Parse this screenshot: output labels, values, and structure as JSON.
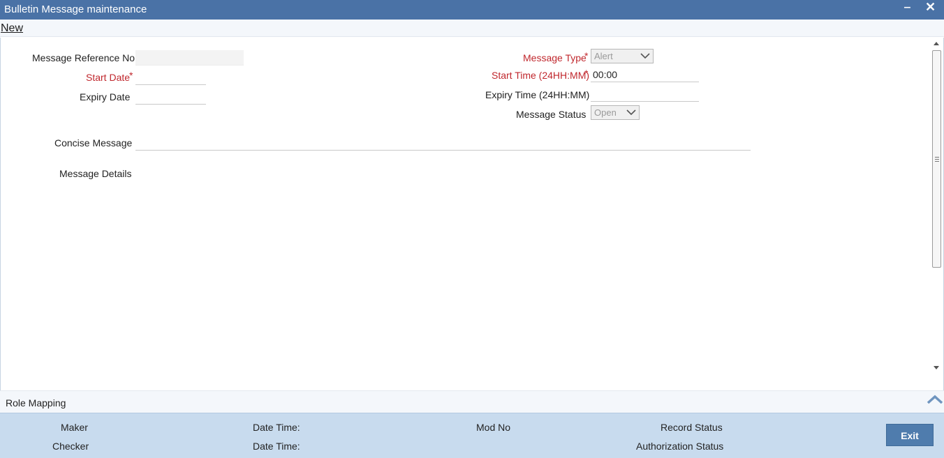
{
  "window": {
    "title": "Bulletin Message maintenance",
    "minimize_glyph": "‒",
    "close_glyph": "✕"
  },
  "toolbar": {
    "new_label": "New"
  },
  "form": {
    "message_reference_no": {
      "label": "Message Reference No",
      "value": ""
    },
    "start_date": {
      "label": "Start Date",
      "value": "",
      "required_mark": "*"
    },
    "expiry_date": {
      "label": "Expiry Date",
      "value": ""
    },
    "message_type": {
      "label": "Message Type",
      "value": "Alert",
      "required_mark": "*"
    },
    "start_time": {
      "label": "Start Time (24HH:MM)",
      "value": "00:00",
      "required_mark": "*"
    },
    "expiry_time": {
      "label": "Expiry Time (24HH:MM)",
      "value": ""
    },
    "message_status": {
      "label": "Message Status",
      "value": "Open"
    },
    "concise_message": {
      "label": "Concise Message",
      "value": ""
    },
    "message_details": {
      "label": "Message Details"
    }
  },
  "role_mapping": {
    "label": "Role Mapping"
  },
  "audit": {
    "maker": "Maker",
    "checker": "Checker",
    "date_time_1": "Date Time:",
    "date_time_2": "Date Time:",
    "mod_no": "Mod No",
    "record_status": "Record Status",
    "authorization_status": "Authorization Status"
  },
  "actions": {
    "exit_label": "Exit"
  },
  "colors": {
    "titlebar": "#4a72a6",
    "required_label": "#c0272d",
    "audit_panel": "#c8dbee",
    "exit_button": "#4f7cad"
  }
}
